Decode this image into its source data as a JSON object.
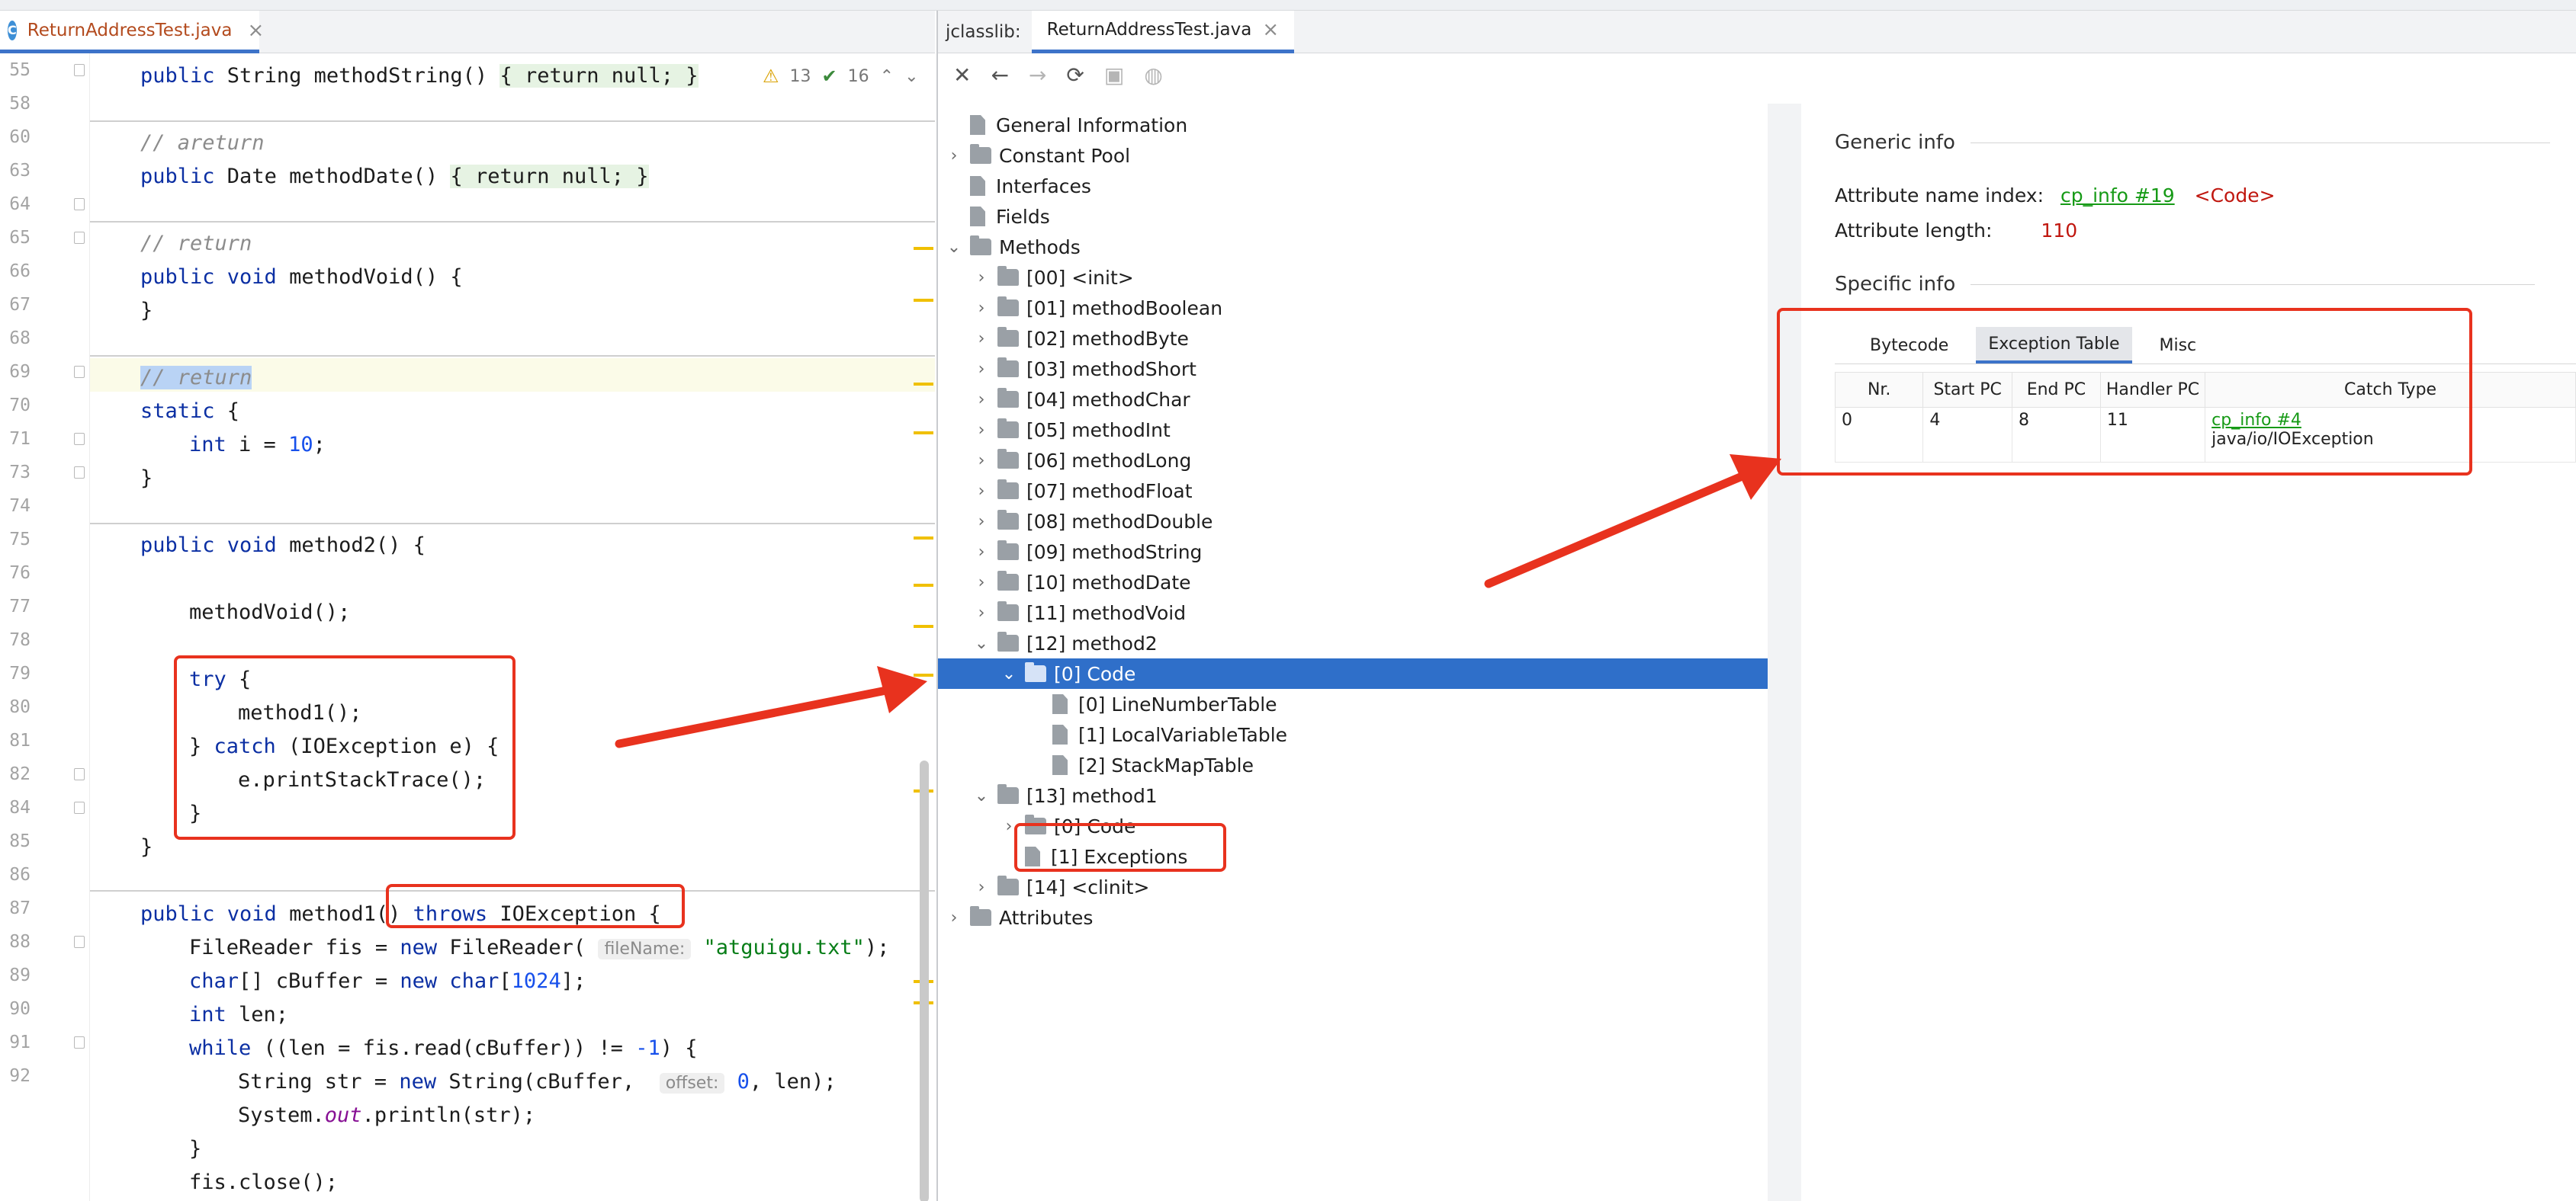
{
  "editor": {
    "tab_title": "ReturnAddressTest.java",
    "file_badge": "C",
    "close_glyph": "×",
    "inspection": {
      "warnings": "13",
      "ok": "16"
    },
    "line_numbers": [
      "55",
      "58",
      "60",
      "63",
      "64",
      "65",
      "66",
      "67",
      "68",
      "69",
      "70",
      "71",
      "73",
      "74",
      "75",
      "76",
      "77",
      "78",
      "79",
      "80",
      "81",
      "82",
      "84",
      "85",
      "86",
      "87",
      "88",
      "89",
      "90",
      "91",
      "92"
    ]
  },
  "code": {
    "l55": {
      "kw": "public",
      "type": " String ",
      "fn": "methodString",
      "rest": "() ",
      "body": "{ return null; }",
      "close": " }"
    },
    "l58": "// areturn",
    "l60": {
      "kw": "public",
      "type": " Date ",
      "fn": "methodDate",
      "rest": "() ",
      "body": "{ return null; }"
    },
    "l63": "// return",
    "l64": {
      "kw": "public void",
      "rest": " methodVoid() {"
    },
    "l65": "}",
    "l67": "// return",
    "l68_kw": "static",
    "l68_rest": " {",
    "l69": {
      "kw": "int",
      "mid": " i = ",
      "num": "10",
      "end": ";"
    },
    "l70": "}",
    "l72": {
      "kw": "public void",
      "rest": " method2() {"
    },
    "l74": "methodVoid();",
    "l76": {
      "kw": "try",
      "rest": " {"
    },
    "l77": "method1();",
    "l78": {
      "pre": "} ",
      "kw": "catch",
      "rest": " (IOException e) {"
    },
    "l79": "e.printStackTrace();",
    "l80": "}",
    "l81": "}",
    "l83": {
      "kw": "public void",
      "rest": " method1() ",
      "kw2": "throws",
      "rest2": " IOException {"
    },
    "l84": {
      "pre": "FileReader fis = ",
      "kw": "new",
      "mid": " FileReader( ",
      "hint": "fileName:",
      "str": " \"atguigu.txt\"",
      "end": ");"
    },
    "l85": {
      "kw": "char",
      "mid": "[] cBuffer = ",
      "kw2": "new char",
      "open": "[",
      "num": "1024",
      "end": "];"
    },
    "l86": {
      "kw": "int",
      "rest": " len;"
    },
    "l87": {
      "kw": "while",
      "mid": " ((len = fis.read(cBuffer)) != ",
      "num": "-1",
      "end": ") {"
    },
    "l88": {
      "pre": "String str = ",
      "kw": "new",
      "mid": " String(cBuffer,  ",
      "hint": "offset:",
      "num": " 0",
      "end": ", len);"
    },
    "l89": {
      "pre": "System.",
      "fld": "out",
      "end": ".println(str);"
    },
    "l90": "}",
    "l91": "fis.close();"
  },
  "jclasslib": {
    "label": "jclasslib:",
    "tab_title": "ReturnAddressTest.java",
    "close_glyph": "×",
    "toolbar": {
      "close": "✕",
      "back": "←",
      "forward": "→",
      "refresh": "⟳",
      "save": "▣",
      "web": "◍"
    },
    "tree": {
      "general": "General Information",
      "constant_pool": "Constant Pool",
      "interfaces": "Interfaces",
      "fields": "Fields",
      "methods": "Methods",
      "m00": "[00] <init>",
      "m01": "[01] methodBoolean",
      "m02": "[02] methodByte",
      "m03": "[03] methodShort",
      "m04": "[04] methodChar",
      "m05": "[05] methodInt",
      "m06": "[06] methodLong",
      "m07": "[07] methodFloat",
      "m08": "[08] methodDouble",
      "m09": "[09] methodString",
      "m10": "[10] methodDate",
      "m11": "[11] methodVoid",
      "m12": "[12] method2",
      "m12_code": "[0] Code",
      "m12_lnt": "[0] LineNumberTable",
      "m12_lvt": "[1] LocalVariableTable",
      "m12_smt": "[2] StackMapTable",
      "m13": "[13] method1",
      "m13_code": "[0] Code",
      "m13_exc": "[1] Exceptions",
      "m14": "[14] <clinit>",
      "attributes": "Attributes"
    },
    "details": {
      "generic_title": "Generic info",
      "name_index_label": "Attribute name index:",
      "name_index_link": "cp_info #19",
      "name_index_value": "<Code>",
      "length_label": "Attribute length:",
      "length_value": "110",
      "specific_title": "Specific info",
      "tabs": [
        "Bytecode",
        "Exception Table",
        "Misc"
      ],
      "table": {
        "headers": [
          "Nr.",
          "Start PC",
          "End PC",
          "Handler PC",
          "Catch Type"
        ],
        "rows": [
          {
            "nr": "0",
            "start": "4",
            "end": "8",
            "handler": "11",
            "catch_link": "cp_info #4",
            "catch_name": "java/io/IOException"
          }
        ]
      }
    }
  },
  "colors": {
    "accent": "#3d73c9",
    "selection": "#2f6fc9",
    "annotation": "#e8321e",
    "link": "#169a16",
    "keyword": "#0b2fa3",
    "string": "#067d17"
  }
}
